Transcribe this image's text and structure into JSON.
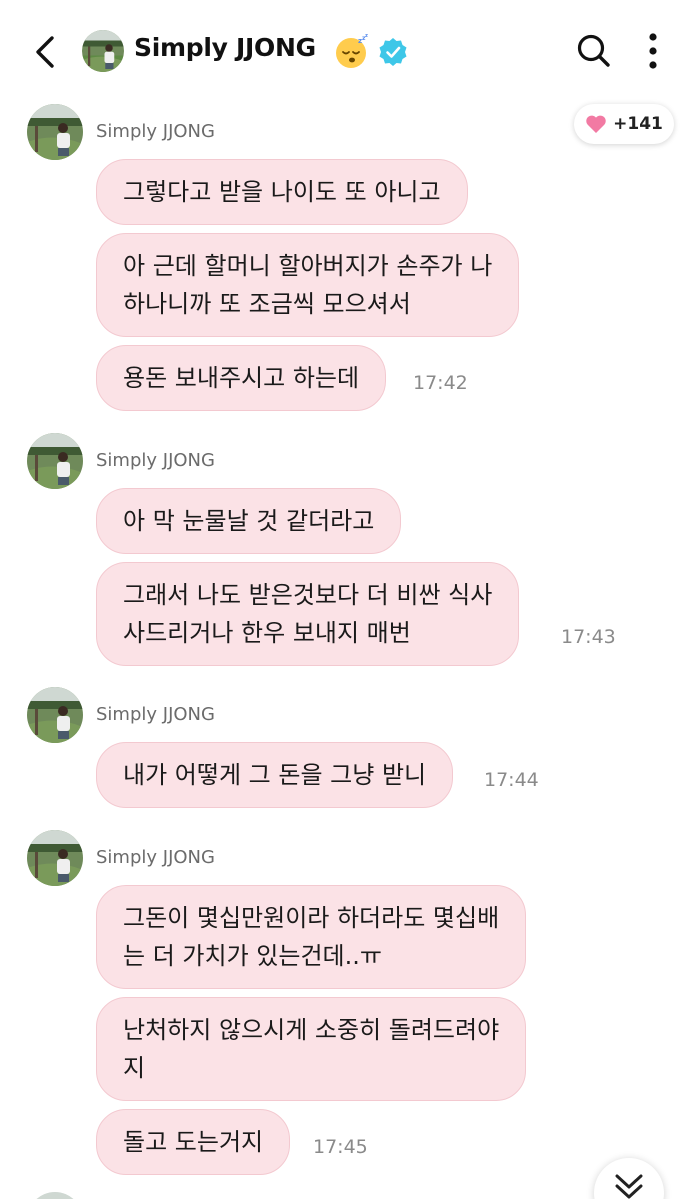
{
  "header": {
    "title": "Simply JJONG",
    "icons": {
      "back": "chevron-left-icon",
      "sleep_emoji": "sleeping-face-emoji",
      "verified": "verified-badge-icon",
      "search": "search-icon",
      "more": "more-vertical-icon"
    }
  },
  "reaction": {
    "icon": "heart-icon",
    "count": "+141",
    "color": "#f27aa3"
  },
  "colors": {
    "bubble_bg": "#fbe2e6",
    "bubble_border": "#f3c9d0",
    "verified": "#3ec7e8"
  },
  "groups": [
    {
      "sender": "Simply JJONG",
      "messages": [
        {
          "lines": [
            "그렇다고 받을 나이도 또 아니고"
          ]
        },
        {
          "lines": [
            "아 근데 할머니 할아버지가 손주가 나",
            "하나니까 또 조금씩 모으셔서"
          ]
        },
        {
          "lines": [
            "용돈 보내주시고 하는데"
          ]
        }
      ],
      "time": "17:42"
    },
    {
      "sender": "Simply JJONG",
      "messages": [
        {
          "lines": [
            "아 막 눈물날 것 같더라고"
          ]
        },
        {
          "lines": [
            "그래서 나도 받은것보다 더 비싼 식사",
            "사드리거나 한우 보내지 매번"
          ]
        }
      ],
      "time": "17:43"
    },
    {
      "sender": "Simply JJONG",
      "messages": [
        {
          "lines": [
            "내가 어떻게 그 돈을 그냥 받니"
          ]
        }
      ],
      "time": "17:44"
    },
    {
      "sender": "Simply JJONG",
      "messages": [
        {
          "lines": [
            "그돈이 몇십만원이라 하더라도 몇십배",
            "는 더 가치가 있는건데..ㅠ"
          ]
        },
        {
          "lines": [
            "난처하지 않으시게 소중히 돌려드려야",
            "지"
          ]
        },
        {
          "lines": [
            "돌고 도는거지"
          ]
        }
      ],
      "time": "17:45"
    }
  ],
  "scroll_button": {
    "icon": "double-chevron-down-icon"
  }
}
